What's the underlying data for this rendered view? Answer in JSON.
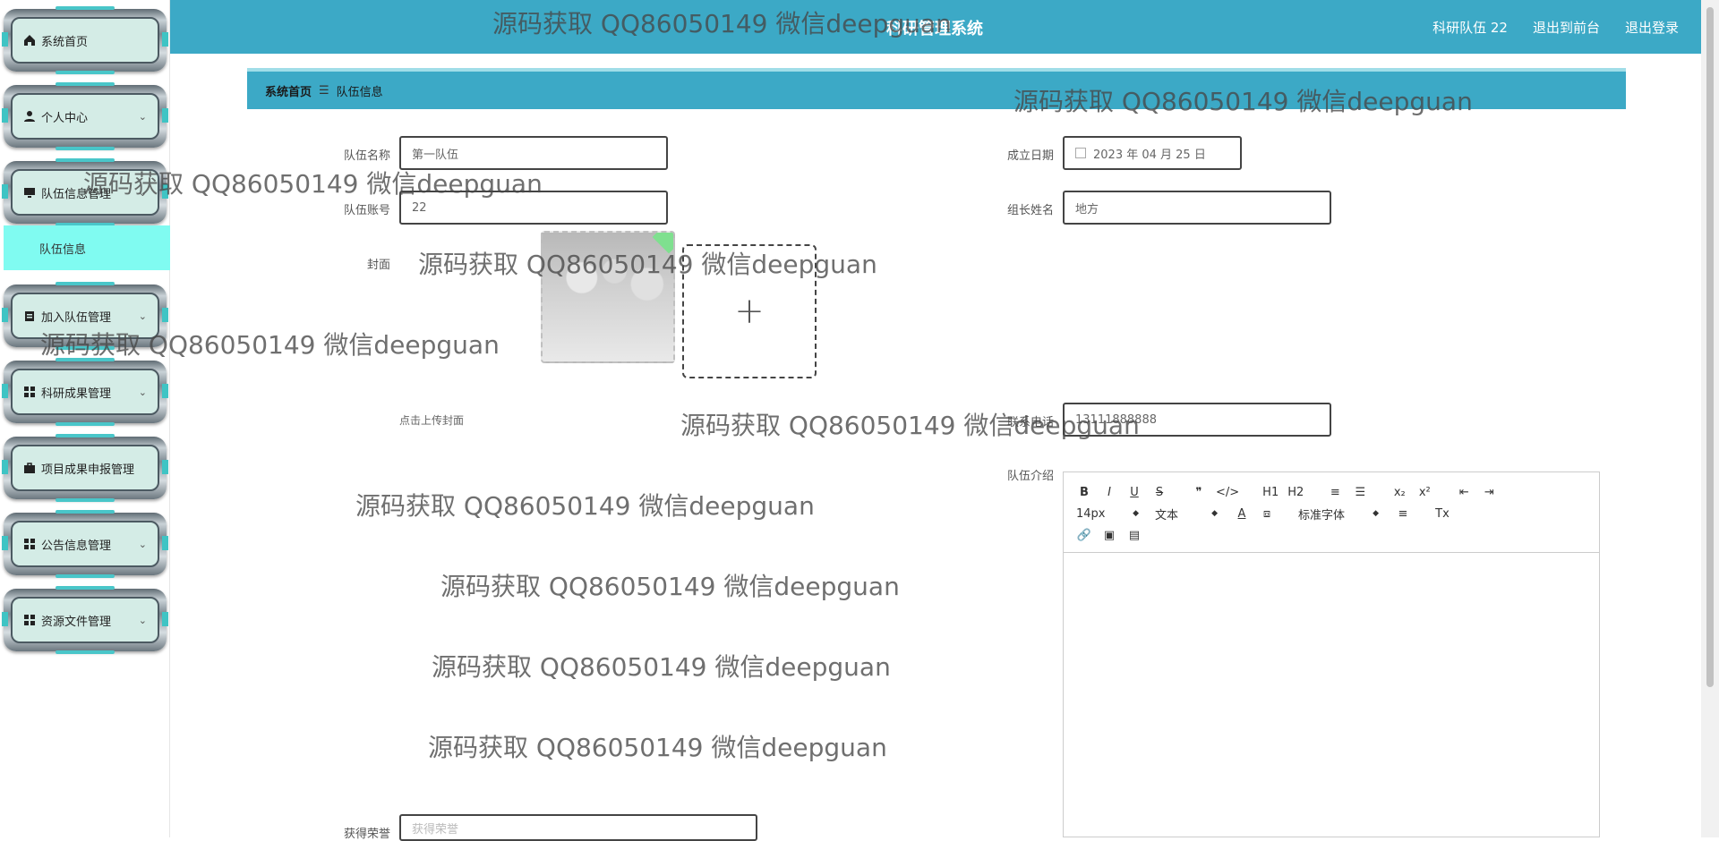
{
  "app": {
    "title": "科研管理系统"
  },
  "header": {
    "links": [
      "科研队伍 22",
      "退出到前台",
      "退出登录"
    ]
  },
  "sidebar": {
    "items": [
      {
        "label": "系统首页",
        "icon": "home-icon",
        "chevron": ""
      },
      {
        "label": "个人中心",
        "icon": "user-icon",
        "chevron": "⌄"
      },
      {
        "label": "队伍信息管理",
        "icon": "monitor-icon",
        "chevron": "⌄"
      },
      {
        "label": "加入队伍管理",
        "icon": "clipboard-icon",
        "chevron": "⌄"
      },
      {
        "label": "科研成果管理",
        "icon": "grid-icon",
        "chevron": "⌄"
      },
      {
        "label": "项目成果申报管理",
        "icon": "briefcase-icon",
        "chevron": ""
      },
      {
        "label": "公告信息管理",
        "icon": "grid-icon",
        "chevron": "⌄"
      },
      {
        "label": "资源文件管理",
        "icon": "grid-icon",
        "chevron": "⌄"
      }
    ],
    "submenu": "队伍信息"
  },
  "breadcrumb": {
    "home": "系统首页",
    "sep": "☰",
    "current": "队伍信息"
  },
  "form": {
    "team_name_label": "队伍名称",
    "team_name_value": "第一队伍",
    "found_date_label": "成立日期",
    "found_date_value": "2023 年 04 月 25 日",
    "team_account_label": "队伍账号",
    "team_account_value": "22",
    "leader_label": "组长姓名",
    "leader_value": "地方",
    "cover_label": "封面",
    "upload_plus": "+",
    "upload_hint": "点击上传封面",
    "phone_label": "联系电话",
    "phone_value": "13111888888",
    "intro_label": "队伍介绍",
    "honor_label": "获得荣誉",
    "honor_placeholder": "获得荣誉"
  },
  "editor": {
    "row1": [
      "B",
      "I",
      "U",
      "S",
      "❞",
      "</>",
      "H1",
      "H2",
      "≡",
      "☰",
      "x₂",
      "x²",
      "⇤",
      "⇥"
    ],
    "font_size": "14px",
    "text_type": "文本",
    "font_family": "标准字体",
    "row2_icons": [
      "A",
      "⧈",
      "≡",
      "Tx"
    ],
    "row3": [
      "🔗",
      "▣",
      "▤"
    ]
  },
  "watermark": "源码获取 QQ86050149 微信deepguan",
  "colors": {
    "header": "#3ca9c6",
    "submenu": "#80fbf1",
    "menu_panel": "#d4ece6"
  }
}
